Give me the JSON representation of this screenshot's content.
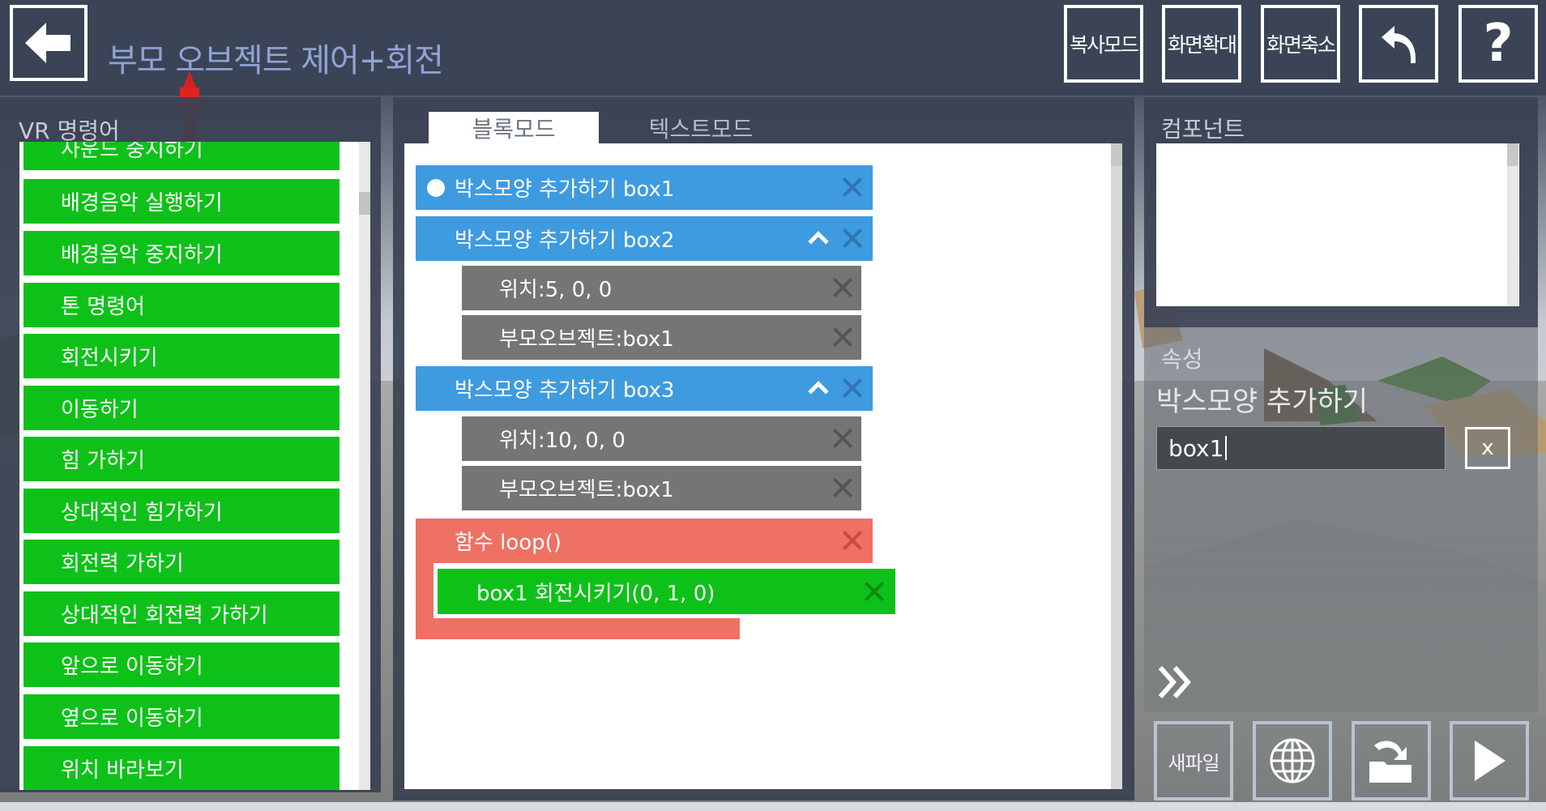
{
  "header": {
    "title": "부모 오브젝트 제어+회전",
    "buttons": {
      "copy_mode": "복사모드",
      "zoom_in": "화면확대",
      "zoom_out": "화면축소",
      "undo_icon": "undo-icon",
      "help_icon": "help-icon"
    }
  },
  "left_panel": {
    "label": "VR 명령어",
    "commands": [
      "사운드 중지하기",
      "배경음악 실행하기",
      "배경음악 중지하기",
      "톤 명령어",
      "회전시키기",
      "이동하기",
      "힘 가하기",
      "상대적인 힘가하기",
      "회전력 가하기",
      "상대적인 회전력 가하기",
      "앞으로 이동하기",
      "옆으로 이동하기",
      "위치 바라보기"
    ]
  },
  "editor": {
    "tabs": {
      "block_mode": "블록모드",
      "text_mode": "텍스트모드"
    },
    "blocks": {
      "b1": "박스모양 추가하기 box1",
      "b2": "박스모양 추가하기 box2",
      "b2_pos": "위치:5, 0, 0",
      "b2_parent": "부모오브젝트:box1",
      "b3": "박스모양 추가하기 box3",
      "b3_pos": "위치:10, 0, 0",
      "b3_parent": "부모오브젝트:box1",
      "loop": "함수 loop()",
      "rotate": "box1 회전시키기(0, 1, 0)"
    }
  },
  "right_panel": {
    "component_label": "컴포넌트",
    "property_label": "속성",
    "property_title": "박스모양 추가하기",
    "name_value": "box1",
    "clear_label": "x",
    "new_file": "새파일"
  },
  "colors": {
    "panel_bg": "#394152",
    "command_green": "#0ec119",
    "block_blue": "#3e9be0",
    "block_gray": "#757575",
    "block_red": "#ee7164",
    "title_blue": "#8fa3d4"
  }
}
